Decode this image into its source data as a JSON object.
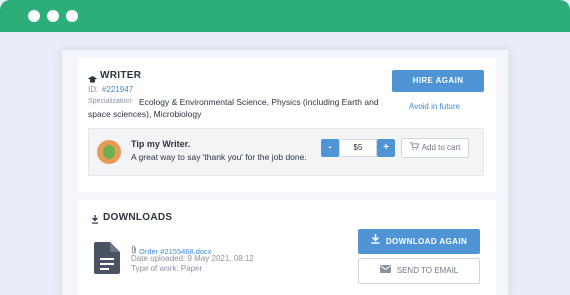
{
  "writer": {
    "title": "WRITER",
    "id_label": "ID:",
    "id_value": "#221947",
    "spec_label": "Specialization:",
    "spec_value_1": "Ecology & Environmental Science, Physics (including Earth and",
    "spec_value_2": "space sciences), Microbiology",
    "hire_again": "HIRE AGAIN",
    "avoid": "Avoid in future"
  },
  "tip": {
    "title": "Tip my Writer.",
    "subtitle": "A great way to say 'thank you' for the job done.",
    "minus": "-",
    "amount": "$5",
    "plus": "+",
    "add_to_cart": "Add to cart"
  },
  "downloads": {
    "title": "DOWNLOADS",
    "file_name": "Order #2155468.docx",
    "date_uploaded": "Date uploaded: 9 May 2021, 08:12",
    "type_of_work": "Type of work: Paper",
    "download_again": "DOWNLOAD AGAIN",
    "send_to_email": "SEND TO EMAIL"
  },
  "colors": {
    "accent_green": "#2dae79",
    "button_blue": "#4f95d6",
    "link_blue": "#3f8ad6"
  },
  "icons": {
    "writer_icon": "graduation-cap-icon",
    "downloads_icon": "download-icon",
    "file_icon": "document-icon",
    "attachment_icon": "paperclip-icon",
    "cart_icon": "cart-icon",
    "email_icon": "envelope-icon"
  }
}
